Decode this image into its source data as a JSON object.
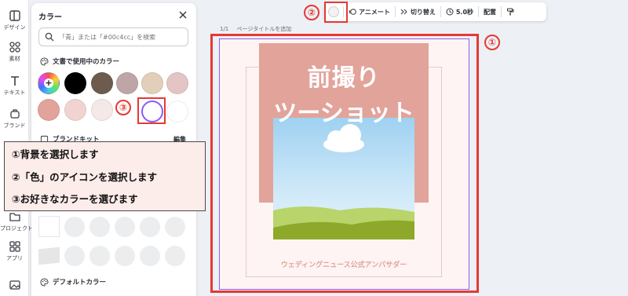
{
  "rail": {
    "items": [
      {
        "label": "デザイン",
        "icon": "layout-icon"
      },
      {
        "label": "素材",
        "icon": "elements-icon"
      },
      {
        "label": "テキスト",
        "icon": "text-icon"
      },
      {
        "label": "ブランド",
        "icon": "brand-icon"
      },
      {
        "label": "プロジェクト",
        "icon": "folder-icon"
      },
      {
        "label": "アプリ",
        "icon": "apps-icon"
      },
      {
        "label": "",
        "icon": "image-icon"
      }
    ]
  },
  "panel": {
    "title": "カラー",
    "search_placeholder": "「青」または「#00c4cc」を検索",
    "doc_colors_heading": "文書で使用中のカラー",
    "doc_colors": [
      "#000000",
      "#6d5c4e",
      "#bea5a8",
      "#e1cfb9",
      "#e4c5c6",
      "#e2a39b",
      "#f1d4d1",
      "#f5e9e8",
      "#ffffff",
      "#ffffff"
    ],
    "brand_kit_heading": "ブランドキット",
    "brand_edit": "編集",
    "default_colors_heading": "デフォルトカラー"
  },
  "toolbar": {
    "animate": "アニメート",
    "transition": "切り替え",
    "duration": "5.0秒",
    "position": "配置"
  },
  "page_header": {
    "page_label": "1/1",
    "title_placeholder": "ページタイトルを追加"
  },
  "design": {
    "title_line1": "前撮り",
    "title_line2": "ツーショット",
    "footer": "ウェディングニュース公式アンバサダー",
    "accent": "#e2a39b",
    "background": "#fdf4f3"
  },
  "annotation": {
    "badge1": "①",
    "badge2": "②",
    "badge3": "③",
    "lines": [
      "①背景を選択します",
      "②「色」のアイコンを選択します",
      "③お好きなカラーを選びます"
    ]
  }
}
